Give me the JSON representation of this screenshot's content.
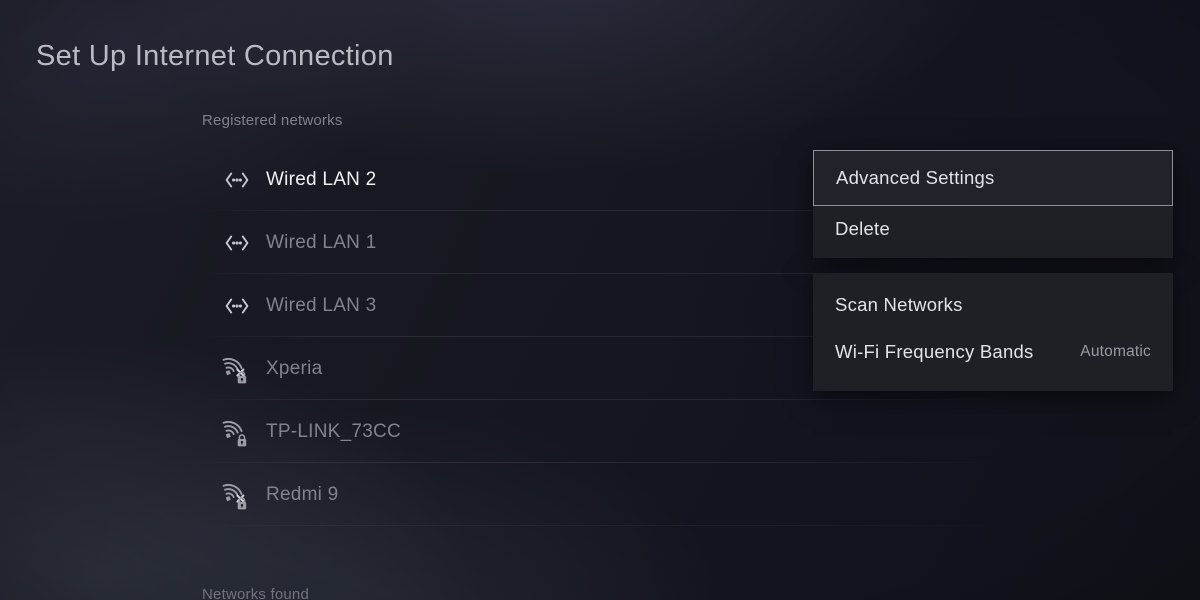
{
  "header": {
    "title": "Set Up Internet Connection"
  },
  "sections": {
    "registered_label": "Registered networks",
    "found_label": "Networks found"
  },
  "networks": [
    {
      "name": "Wired LAN 2",
      "icon": "wired-lan-icon",
      "selected": true,
      "locked": false,
      "out_of_range": false
    },
    {
      "name": "Wired LAN 1",
      "icon": "wired-lan-icon",
      "selected": false,
      "locked": false,
      "out_of_range": false
    },
    {
      "name": "Wired LAN 3",
      "icon": "wired-lan-icon",
      "selected": false,
      "locked": false,
      "out_of_range": false
    },
    {
      "name": "Xperia",
      "icon": "wifi-icon",
      "selected": false,
      "locked": true,
      "out_of_range": true
    },
    {
      "name": "TP-LINK_73CC",
      "icon": "wifi-icon",
      "selected": false,
      "locked": true,
      "out_of_range": false
    },
    {
      "name": "Redmi 9",
      "icon": "wifi-icon",
      "selected": false,
      "locked": true,
      "out_of_range": true
    }
  ],
  "context_menu": {
    "primary": [
      {
        "label": "Advanced Settings",
        "focused": true
      },
      {
        "label": "Delete",
        "focused": false
      }
    ],
    "secondary": [
      {
        "label": "Scan Networks",
        "value": "",
        "focused": false
      },
      {
        "label": "Wi-Fi Frequency Bands",
        "value": "Automatic",
        "focused": false
      }
    ]
  },
  "colors": {
    "background": "#14141c",
    "menu_panel": "#1f1f26",
    "text_primary": "#f1f1f4",
    "text_dim": "#80828d",
    "text_title": "#b9bac4",
    "focus_border": "#8e8f99"
  }
}
